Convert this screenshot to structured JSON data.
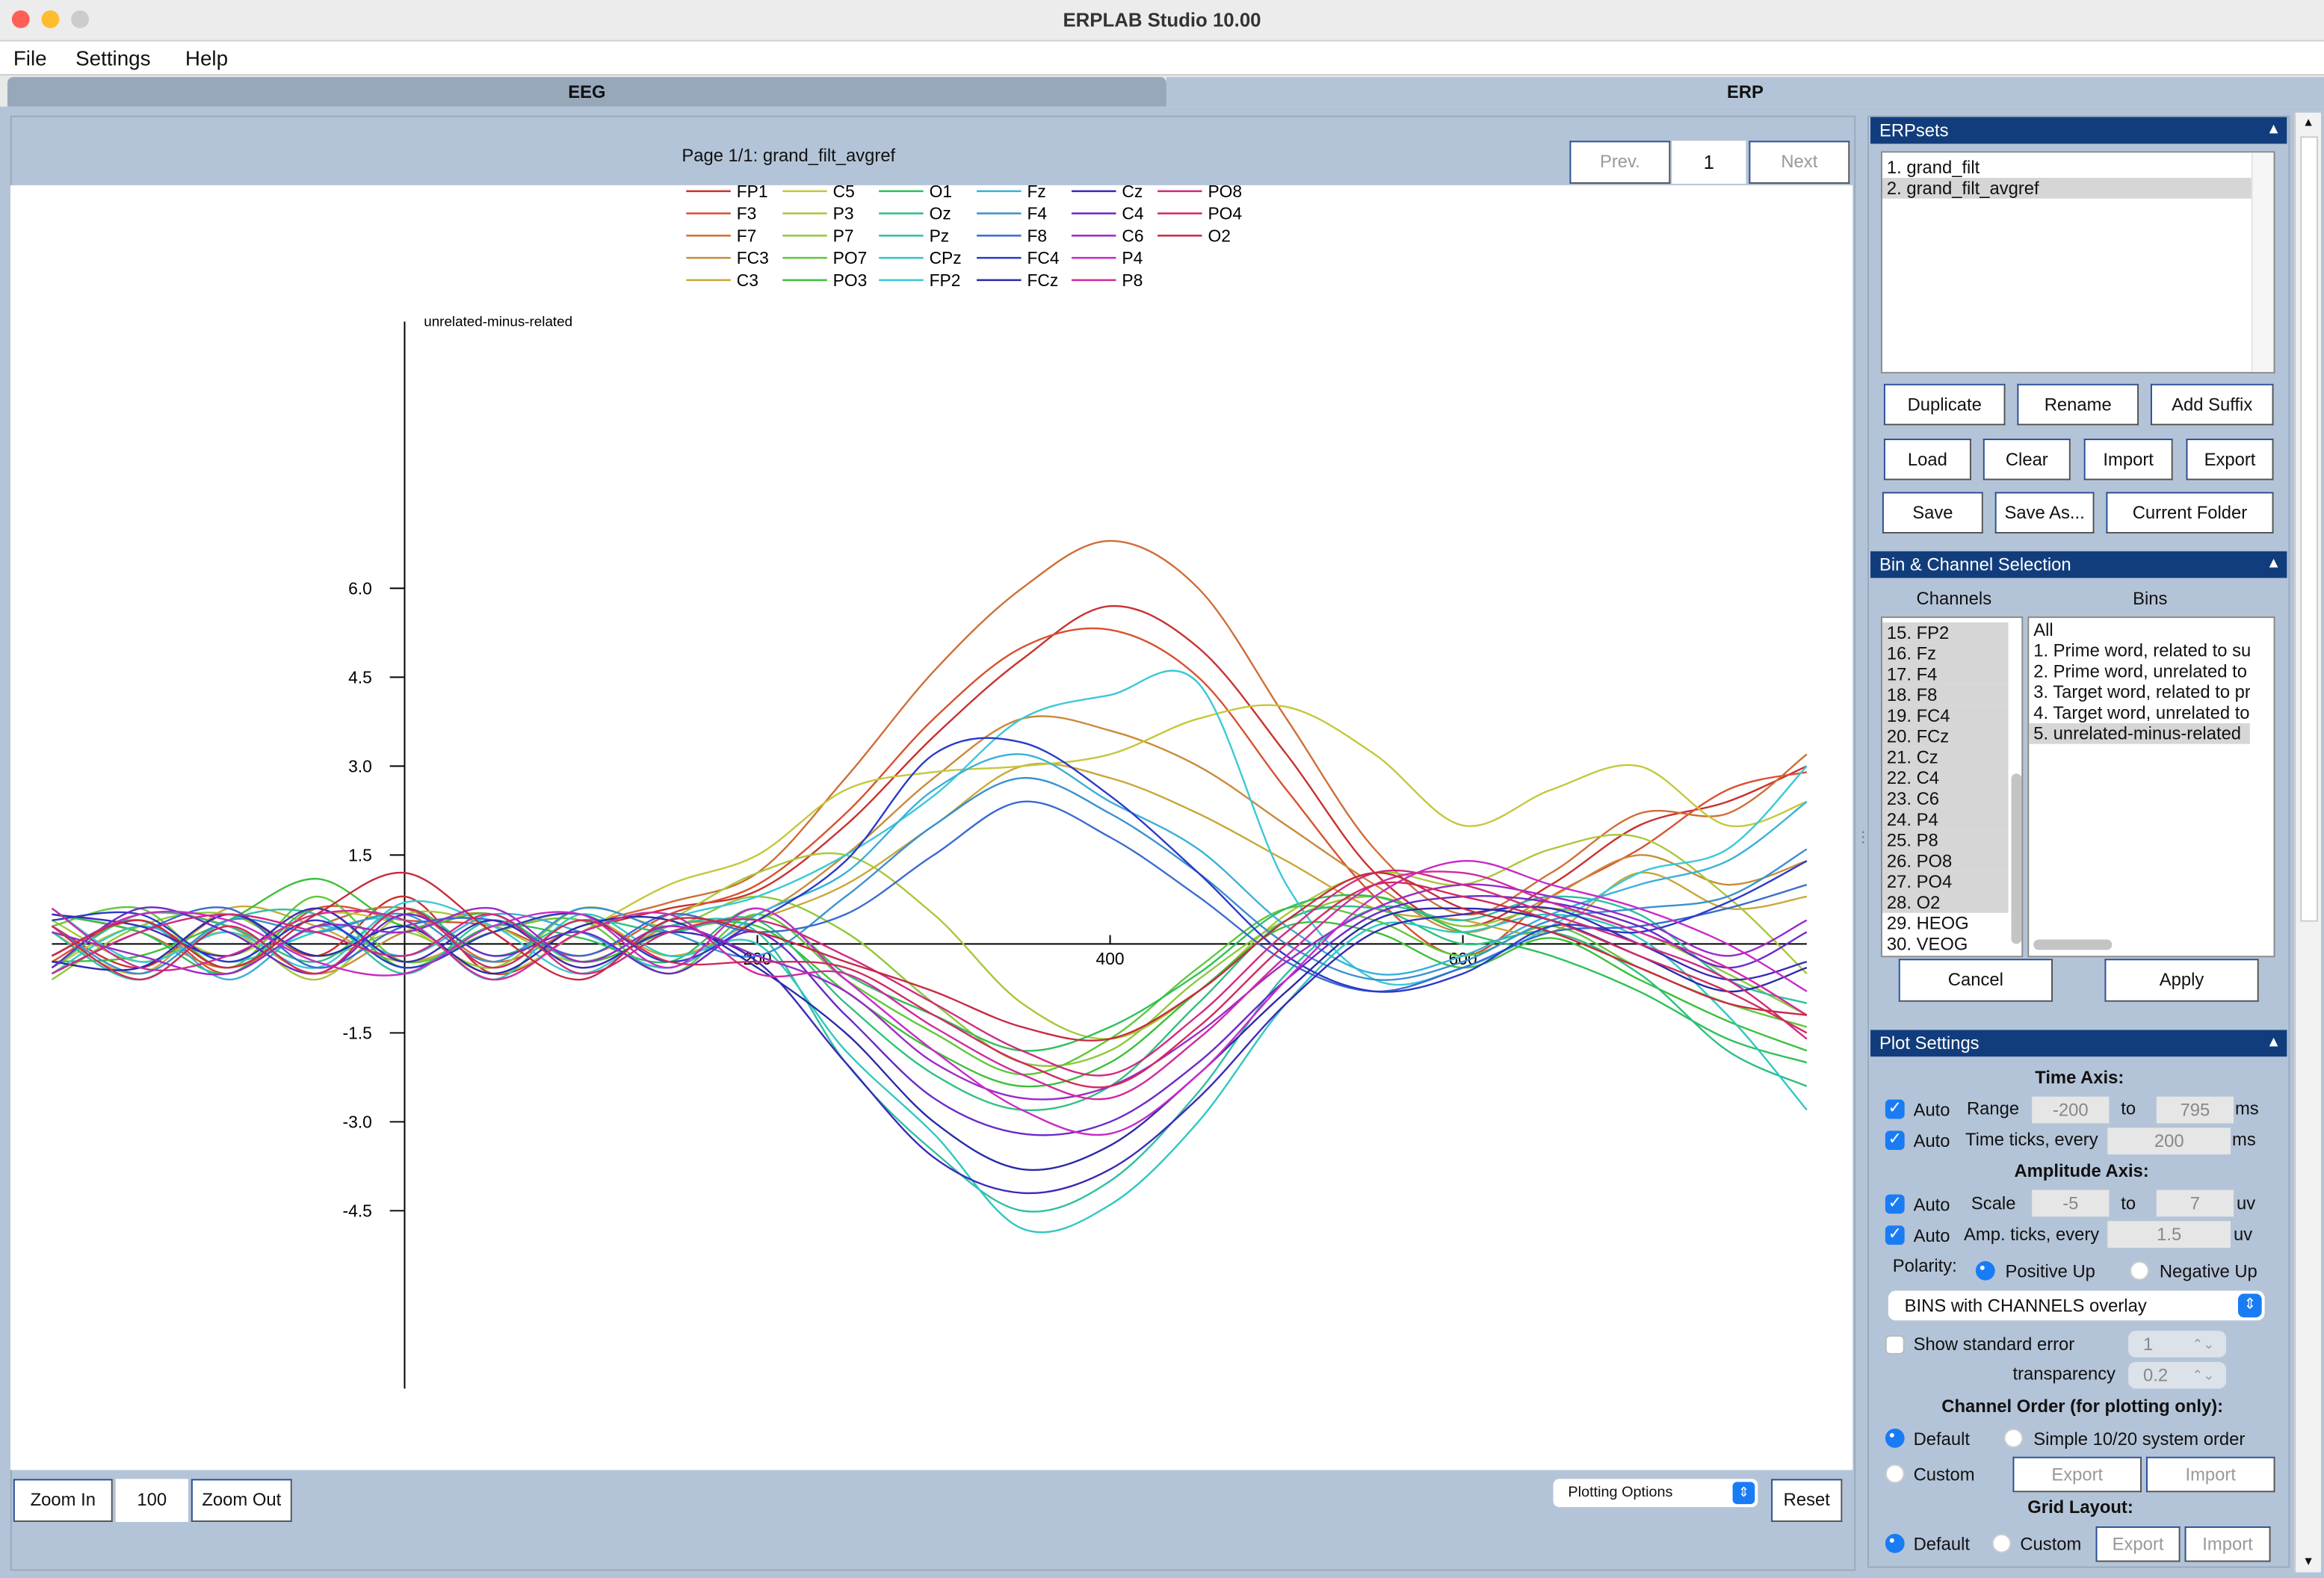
{
  "window": {
    "title": "ERPLAB Studio 10.00"
  },
  "menu": [
    "File",
    "Settings",
    "Help"
  ],
  "tabs": [
    {
      "label": "EEG",
      "active": false
    },
    {
      "label": "ERP",
      "active": true
    }
  ],
  "plot_header": {
    "page_label": "Page 1/1: grand_filt_avgref",
    "prev_label": "Prev.",
    "page_value": "1",
    "next_label": "Next"
  },
  "plot_footer": {
    "zoom_in": "Zoom In",
    "zoom_value": "100",
    "zoom_out": "Zoom Out",
    "plotting_options": "Plotting Options",
    "reset": "Reset"
  },
  "chart_data": {
    "type": "line",
    "title": "unrelated-minus-related",
    "xlabel": "",
    "ylabel": "",
    "xlim": [
      -200,
      795
    ],
    "ylim": [
      -7.5,
      10.5
    ],
    "x_ticks": [
      200,
      400,
      600
    ],
    "y_ticks": [
      -4.5,
      -3.0,
      -1.5,
      1.5,
      3.0,
      4.5,
      6.0
    ],
    "y_tick_labels": [
      "-4.5",
      "-3.0",
      "-1.5",
      "1.5",
      "3.0",
      "4.5",
      "6.0"
    ],
    "x_tick_labels": [
      "200",
      "400",
      "600"
    ],
    "legend_position": "top",
    "grid": false,
    "x": [
      -200,
      -150,
      -100,
      -50,
      0,
      50,
      100,
      150,
      200,
      250,
      300,
      350,
      400,
      450,
      500,
      550,
      600,
      650,
      700,
      750,
      795
    ],
    "series": [
      {
        "name": "FP1",
        "color": "#c8302e",
        "values": [
          0.3,
          -0.4,
          0.5,
          -0.2,
          0.8,
          -0.5,
          0.2,
          0.6,
          0.9,
          2.0,
          3.5,
          4.8,
          5.7,
          5.0,
          3.2,
          1.2,
          0.3,
          1.0,
          2.0,
          2.4,
          3.0
        ]
      },
      {
        "name": "F3",
        "color": "#d9502e",
        "values": [
          -0.3,
          0.4,
          -0.5,
          0.6,
          0.4,
          0.3,
          -0.2,
          0.5,
          1.0,
          2.2,
          3.8,
          5.0,
          5.3,
          4.5,
          2.6,
          0.8,
          -0.2,
          0.8,
          1.6,
          2.6,
          2.9
        ]
      },
      {
        "name": "F7",
        "color": "#cf6e36",
        "values": [
          0.5,
          0.2,
          -0.4,
          0.3,
          0.6,
          -0.3,
          0.3,
          0.7,
          1.2,
          2.8,
          4.6,
          6.0,
          6.8,
          6.0,
          3.8,
          1.6,
          0.5,
          1.2,
          2.2,
          2.2,
          3.2
        ]
      },
      {
        "name": "FC3",
        "color": "#c98a3a",
        "values": [
          -0.2,
          0.5,
          0.3,
          -0.5,
          0.2,
          0.5,
          -0.4,
          0.3,
          0.5,
          1.5,
          2.8,
          3.8,
          3.6,
          3.0,
          2.0,
          1.0,
          0.2,
          0.8,
          1.5,
          1.0,
          1.4
        ]
      },
      {
        "name": "C3",
        "color": "#c9a838",
        "values": [
          0.2,
          -0.5,
          0.6,
          0.3,
          -0.3,
          0.2,
          0.5,
          -0.2,
          0.4,
          1.0,
          2.0,
          3.0,
          2.8,
          2.2,
          1.4,
          0.6,
          0.4,
          0.2,
          1.2,
          0.6,
          0.8
        ]
      },
      {
        "name": "C5",
        "color": "#c4c83a",
        "values": [
          -0.4,
          0.3,
          -0.2,
          0.5,
          0.3,
          -0.5,
          0.2,
          1.0,
          1.5,
          2.6,
          2.9,
          3.0,
          3.2,
          3.8,
          4.0,
          3.2,
          2.0,
          2.6,
          3.0,
          2.0,
          2.4
        ]
      },
      {
        "name": "P3",
        "color": "#a8c83a",
        "values": [
          0.4,
          -0.3,
          0.2,
          -0.6,
          0.5,
          0.3,
          -0.3,
          0.4,
          1.2,
          1.5,
          0.5,
          -1.0,
          -1.6,
          -0.8,
          0.5,
          1.2,
          1.0,
          1.6,
          1.8,
          0.8,
          -0.5
        ]
      },
      {
        "name": "P7",
        "color": "#8ec83a",
        "values": [
          -0.6,
          0.3,
          0.5,
          -0.2,
          0.2,
          -0.4,
          0.6,
          0.3,
          0.8,
          0.2,
          -1.0,
          -2.0,
          -1.8,
          -0.6,
          0.4,
          0.8,
          0.3,
          0.6,
          0.2,
          -0.5,
          -1.2
        ]
      },
      {
        "name": "PO7",
        "color": "#5ec83a",
        "values": [
          0.3,
          0.6,
          -0.4,
          0.8,
          -0.3,
          0.2,
          0.4,
          -0.5,
          0.5,
          -0.6,
          -1.5,
          -2.2,
          -1.6,
          -0.4,
          0.6,
          0.4,
          -0.2,
          0.3,
          -0.4,
          -1.0,
          -1.4
        ]
      },
      {
        "name": "PO3",
        "color": "#3cc03a",
        "values": [
          -0.3,
          -0.2,
          0.4,
          1.1,
          0.3,
          0.5,
          -0.3,
          0.2,
          0.3,
          -0.8,
          -1.8,
          -2.4,
          -2.0,
          -0.8,
          0.3,
          0.2,
          -0.4,
          0.1,
          -0.6,
          -1.3,
          -1.8
        ]
      },
      {
        "name": "O1",
        "color": "#2ec05a",
        "values": [
          0.5,
          0.2,
          -0.5,
          0.6,
          -0.4,
          0.3,
          0.1,
          -0.3,
          0.6,
          -0.5,
          -1.2,
          -1.8,
          -1.4,
          -0.5,
          0.6,
          0.8,
          0.2,
          -0.2,
          -0.8,
          -1.6,
          -2.0
        ]
      },
      {
        "name": "Oz",
        "color": "#2ec080",
        "values": [
          -0.4,
          0.5,
          0.3,
          -0.3,
          0.6,
          -0.2,
          0.4,
          0.2,
          0.4,
          -1.0,
          -2.2,
          -2.8,
          -2.4,
          -1.0,
          0.4,
          0.6,
          0.0,
          0.2,
          -0.5,
          -1.8,
          -2.4
        ]
      },
      {
        "name": "Pz",
        "color": "#2ec0a0",
        "values": [
          0.2,
          -0.6,
          0.4,
          0.5,
          -0.5,
          0.4,
          -0.3,
          0.3,
          0.2,
          -2.0,
          -3.5,
          -4.5,
          -4.0,
          -2.5,
          -0.5,
          0.6,
          0.4,
          0.8,
          0.5,
          -0.6,
          -1.0
        ]
      },
      {
        "name": "CPz",
        "color": "#2ec8c0",
        "values": [
          -0.5,
          0.3,
          -0.3,
          0.2,
          0.4,
          -0.6,
          0.5,
          -0.2,
          0.0,
          -1.8,
          -3.2,
          -4.8,
          -4.4,
          -3.0,
          -1.0,
          0.3,
          0.2,
          0.5,
          0.1,
          -1.2,
          -2.8
        ]
      },
      {
        "name": "FP2",
        "color": "#3ac8d8",
        "values": [
          0.6,
          -0.3,
          0.2,
          -0.4,
          0.7,
          0.3,
          -0.5,
          0.4,
          0.8,
          1.5,
          2.5,
          3.8,
          4.2,
          4.4,
          1.0,
          -0.6,
          -0.4,
          0.3,
          1.2,
          1.6,
          3.0
        ]
      },
      {
        "name": "Fz",
        "color": "#3ab0d8",
        "values": [
          -0.2,
          0.4,
          -0.6,
          0.3,
          -0.2,
          0.5,
          0.2,
          -0.4,
          0.5,
          1.2,
          2.6,
          3.2,
          2.4,
          1.6,
          0.3,
          -0.5,
          -0.2,
          0.5,
          1.0,
          1.4,
          2.4
        ]
      },
      {
        "name": "F4",
        "color": "#3a90d0",
        "values": [
          0.3,
          -0.5,
          0.4,
          0.2,
          0.5,
          -0.3,
          0.6,
          0.2,
          -0.2,
          0.8,
          2.0,
          2.8,
          2.2,
          1.2,
          0.0,
          -0.6,
          -0.3,
          0.4,
          0.6,
          0.8,
          1.6
        ]
      },
      {
        "name": "F8",
        "color": "#3a6ad0",
        "values": [
          -0.5,
          0.2,
          0.6,
          -0.4,
          0.3,
          0.4,
          -0.2,
          0.5,
          0.2,
          0.5,
          1.5,
          2.4,
          1.8,
          0.8,
          -0.3,
          -0.8,
          -0.4,
          0.2,
          0.3,
          0.6,
          1.0
        ]
      },
      {
        "name": "FC4",
        "color": "#2a3ac8",
        "values": [
          0.4,
          0.5,
          -0.3,
          0.4,
          -0.4,
          0.2,
          0.5,
          -0.3,
          0.4,
          1.4,
          3.2,
          3.4,
          2.5,
          1.2,
          -0.2,
          -0.8,
          -0.5,
          0.3,
          0.2,
          0.7,
          1.4
        ]
      },
      {
        "name": "FCz",
        "color": "#2a2aa8",
        "values": [
          -0.3,
          -0.4,
          0.5,
          -0.2,
          0.3,
          -0.5,
          0.3,
          0.4,
          -0.4,
          -1.5,
          -3.0,
          -3.8,
          -3.4,
          -2.2,
          -0.8,
          0.4,
          0.6,
          0.4,
          -0.2,
          -0.8,
          -0.4
        ]
      },
      {
        "name": "Cz",
        "color": "#3a2ab8",
        "values": [
          0.5,
          0.3,
          -0.2,
          0.6,
          -0.3,
          0.4,
          -0.4,
          0.2,
          -0.3,
          -2.0,
          -3.6,
          -4.2,
          -3.8,
          -2.6,
          -1.0,
          0.2,
          0.5,
          0.6,
          0.0,
          -0.6,
          -0.3
        ]
      },
      {
        "name": "C4",
        "color": "#6a2ac8",
        "values": [
          -0.4,
          0.6,
          0.2,
          -0.5,
          0.5,
          -0.2,
          0.2,
          -0.5,
          0.2,
          -1.2,
          -2.6,
          -3.2,
          -3.0,
          -2.0,
          -0.6,
          0.5,
          0.8,
          0.7,
          0.3,
          -0.4,
          0.2
        ]
      },
      {
        "name": "C6",
        "color": "#9a2ac8",
        "values": [
          0.2,
          -0.2,
          -0.5,
          0.3,
          0.2,
          0.6,
          -0.3,
          0.3,
          -0.2,
          -0.8,
          -2.0,
          -2.6,
          -2.4,
          -1.5,
          -0.3,
          0.6,
          1.0,
          0.8,
          0.4,
          -0.2,
          0.4
        ]
      },
      {
        "name": "P4",
        "color": "#c82ac8",
        "values": [
          -0.2,
          0.5,
          0.4,
          -0.3,
          -0.5,
          0.3,
          0.5,
          -0.4,
          0.6,
          -0.6,
          -1.8,
          -2.8,
          -3.2,
          -2.2,
          -0.6,
          0.8,
          1.4,
          1.0,
          0.6,
          0.0,
          -0.8
        ]
      },
      {
        "name": "P8",
        "color": "#d02aa0",
        "values": [
          0.6,
          -0.4,
          -0.2,
          0.5,
          0.4,
          -0.6,
          0.2,
          0.5,
          -0.5,
          -0.5,
          -1.4,
          -2.2,
          -2.6,
          -1.6,
          -0.2,
          1.0,
          1.2,
          0.7,
          0.2,
          -0.4,
          -1.2
        ]
      },
      {
        "name": "PO8",
        "color": "#d02a80",
        "values": [
          -0.5,
          0.2,
          0.5,
          0.2,
          -0.2,
          0.5,
          -0.5,
          0.2,
          0.4,
          -0.2,
          -1.0,
          -1.8,
          -2.2,
          -1.2,
          0.2,
          1.2,
          1.0,
          0.5,
          0.0,
          -0.6,
          -1.6
        ]
      },
      {
        "name": "PO4",
        "color": "#d02a60",
        "values": [
          0.3,
          -0.6,
          0.3,
          -0.5,
          0.6,
          -0.4,
          0.4,
          -0.3,
          -0.3,
          -0.4,
          -1.2,
          -2.0,
          -2.4,
          -1.4,
          0.0,
          1.0,
          0.8,
          0.4,
          -0.2,
          -0.8,
          -1.5
        ]
      },
      {
        "name": "O2",
        "color": "#c82a40",
        "values": [
          -0.2,
          0.4,
          -0.4,
          0.5,
          1.2,
          0.2,
          -0.6,
          0.4,
          0.2,
          -0.3,
          -0.8,
          -1.4,
          -1.6,
          -0.8,
          0.4,
          1.2,
          0.6,
          0.2,
          -0.4,
          -1.0,
          -1.2
        ]
      }
    ]
  },
  "erpsets": {
    "header": "ERPsets",
    "items": [
      "1. grand_filt",
      "2. grand_filt_avgref"
    ],
    "selected": 1,
    "buttons": [
      "Duplicate",
      "Rename",
      "Add Suffix",
      "Load",
      "Clear",
      "Import",
      "Export",
      "Save",
      "Save As...",
      "Current Folder"
    ]
  },
  "bin_channel": {
    "header": "Bin & Channel Selection",
    "channels_label": "Channels",
    "bins_label": "Bins",
    "channels": [
      "15. FP2",
      "16. Fz",
      "17. F4",
      "18. F8",
      "19. FC4",
      "20. FCz",
      "21. Cz",
      "22. C4",
      "23. C6",
      "24. P4",
      "25. P8",
      "26. PO8",
      "27. PO4",
      "28. O2",
      "29. HEOG",
      "30. VEOG"
    ],
    "channels_selected_count": 14,
    "bins": [
      "All",
      "1. Prime word, related to su",
      "2. Prime word, unrelated to",
      "3. Target word, related to pr",
      "4. Target word, unrelated to",
      "5. unrelated-minus-related"
    ],
    "bins_selected": 5,
    "cancel": "Cancel",
    "apply": "Apply"
  },
  "plot_settings": {
    "header": "Plot Settings",
    "time_axis": "Time Axis:",
    "auto": "Auto",
    "range": "Range",
    "range_from": "-200",
    "to": "to",
    "range_to": "795",
    "ms": "ms",
    "time_ticks": "Time ticks, every",
    "time_ticks_value": "200",
    "amp_axis": "Amplitude Axis:",
    "scale": "Scale",
    "scale_from": "-5",
    "scale_to": "7",
    "uv": "uv",
    "amp_ticks": "Amp. ticks, every",
    "amp_ticks_value": "1.5",
    "polarity": "Polarity:",
    "positive_up": "Positive Up",
    "negative_up": "Negative Up",
    "overlay_mode": "BINS with CHANNELS overlay",
    "show_se": "Show standard error",
    "se_value": "1",
    "transparency": "transparency",
    "transparency_value": "0.2",
    "channel_order": "Channel Order (for plotting only):",
    "default": "Default",
    "simple_1020": "Simple 10/20 system order",
    "custom": "Custom",
    "export": "Export",
    "import": "Import",
    "grid_layout": "Grid Layout:"
  }
}
